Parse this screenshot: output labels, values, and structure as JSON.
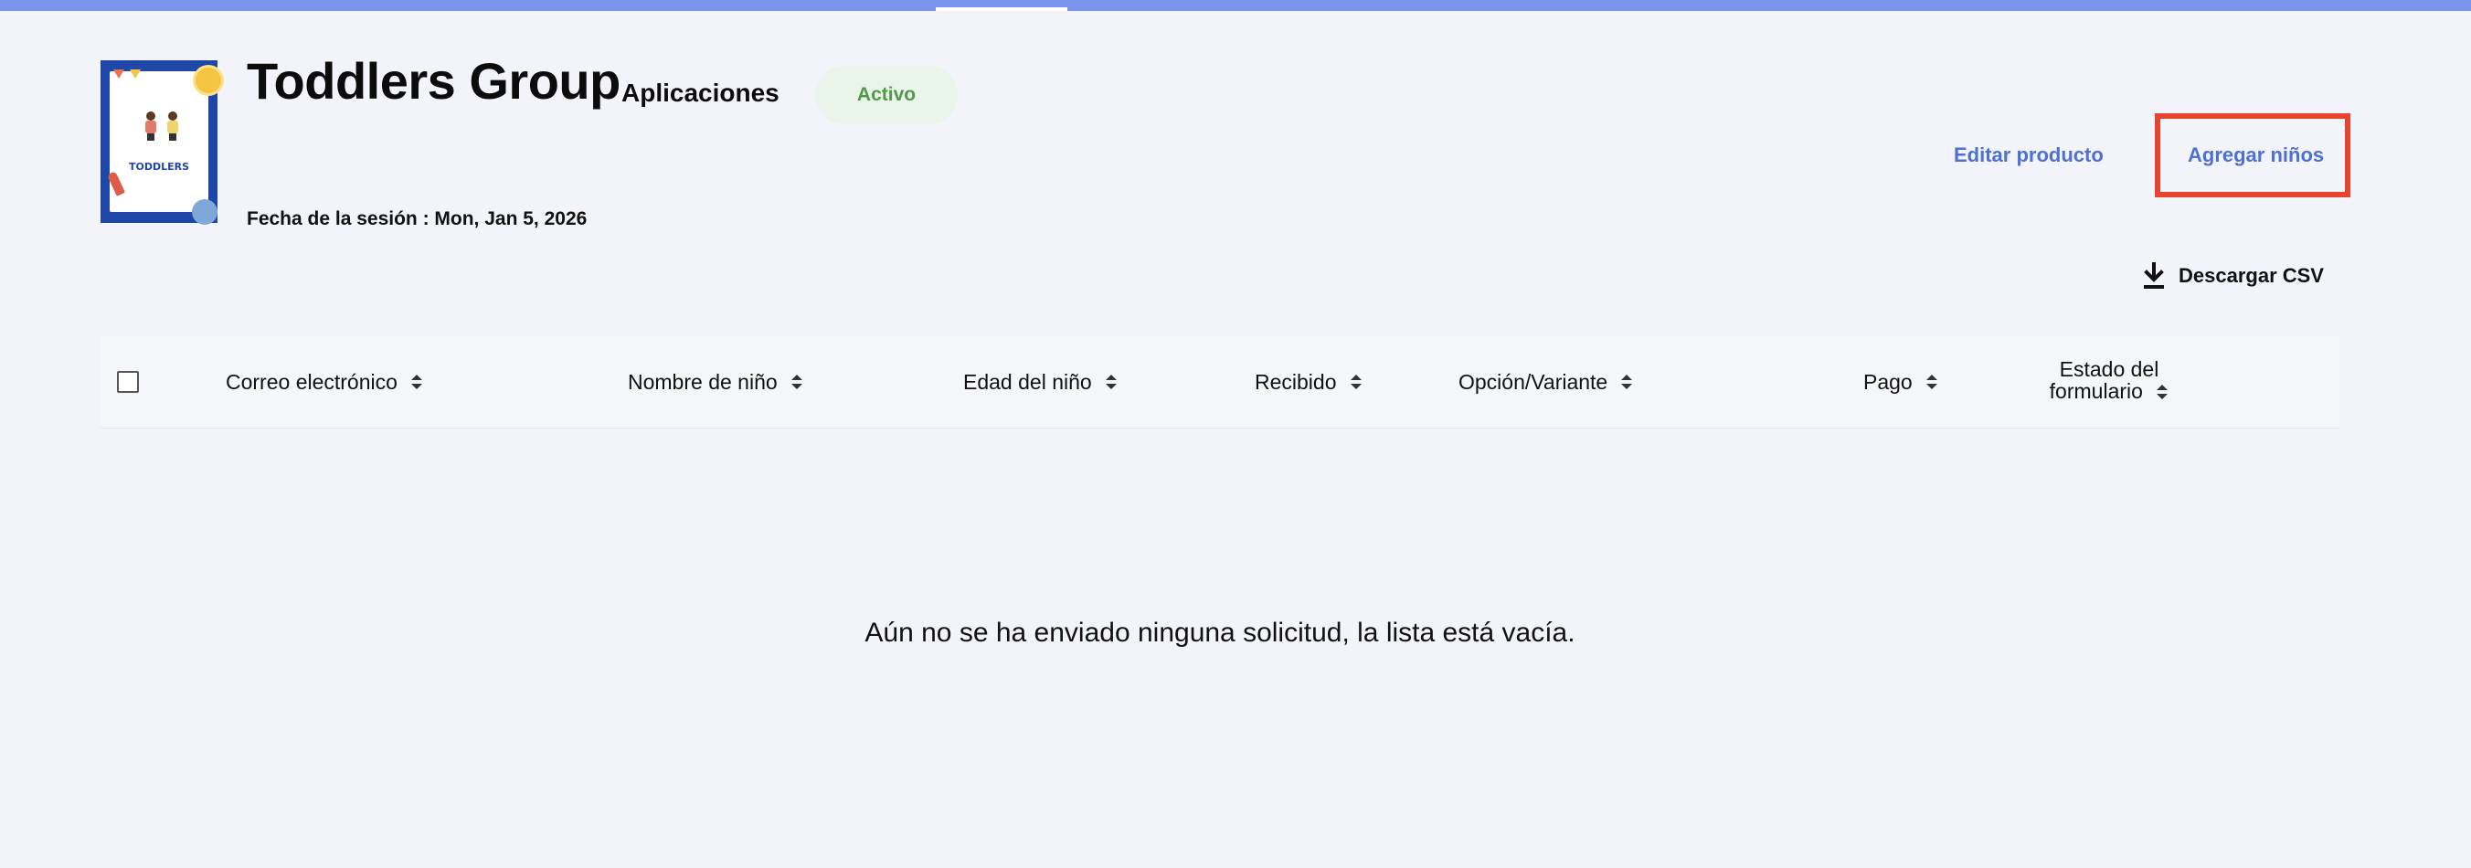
{
  "header": {
    "title": "Toddlers Group",
    "subtitle": "Aplicaciones",
    "status": "Activo",
    "session_date": "Fecha de la sesión : Mon, Jan 5, 2026",
    "thumbnail_text": "TODDLERS"
  },
  "actions": {
    "edit_product": "Editar producto",
    "add_children": "Agregar niños",
    "download_csv": "Descargar CSV"
  },
  "table": {
    "columns": [
      "Correo electrónico",
      "Nombre de niño",
      "Edad del niño",
      "Recibido",
      "Opción/Variante",
      "Pago"
    ],
    "form_status_line1": "Estado del",
    "form_status_line2": "formulario"
  },
  "empty_message": "Aún no se ha enviado ninguna solicitud, la lista está vacía.",
  "colors": {
    "accent": "#4c70d6",
    "highlight": "#e8432e",
    "status_text": "#4f9a4a",
    "status_bg": "#e9f5e9",
    "top_bar": "#7b93ea"
  },
  "icons": {
    "download": "download-icon",
    "sort": "sort-icon"
  }
}
